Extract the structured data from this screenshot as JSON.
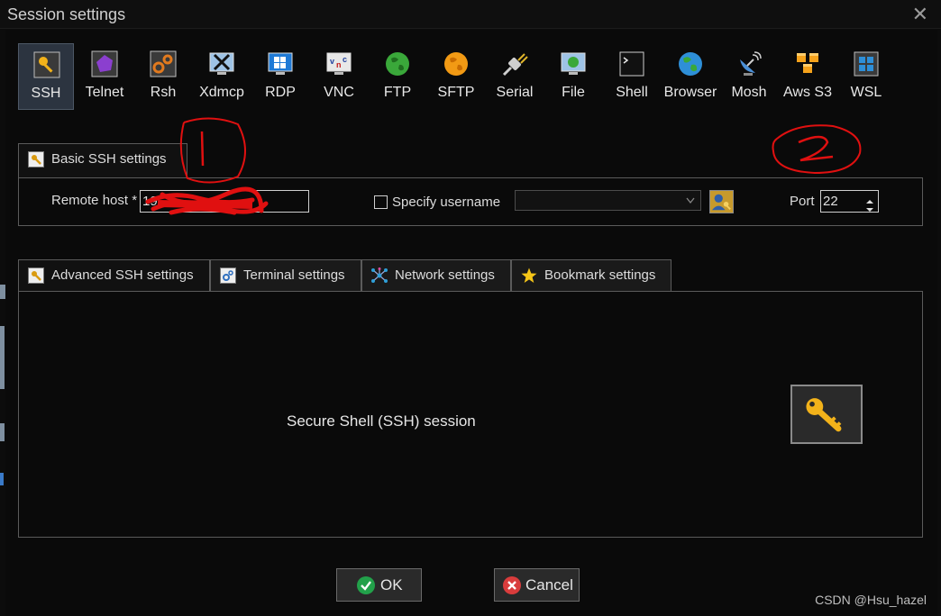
{
  "window": {
    "title": "Session settings",
    "close_glyph": "✕"
  },
  "toolbar": {
    "items": [
      {
        "label": "SSH",
        "icon": "ssh-key-icon",
        "active": true
      },
      {
        "label": "Telnet",
        "icon": "telnet-icon"
      },
      {
        "label": "Rsh",
        "icon": "rsh-icon"
      },
      {
        "label": "Xdmcp",
        "icon": "xdmcp-icon"
      },
      {
        "label": "RDP",
        "icon": "rdp-icon"
      },
      {
        "label": "VNC",
        "icon": "vnc-icon"
      },
      {
        "label": "FTP",
        "icon": "ftp-globe-icon"
      },
      {
        "label": "SFTP",
        "icon": "sftp-globe-icon"
      },
      {
        "label": "Serial",
        "icon": "serial-plug-icon"
      },
      {
        "label": "File",
        "icon": "file-monitor-icon"
      },
      {
        "label": "Shell",
        "icon": "shell-terminal-icon"
      },
      {
        "label": "Browser",
        "icon": "browser-globe-icon"
      },
      {
        "label": "Mosh",
        "icon": "mosh-satellite-icon"
      },
      {
        "label": "Aws S3",
        "icon": "aws-s3-cubes-icon"
      },
      {
        "label": "WSL",
        "icon": "wsl-windows-icon"
      }
    ]
  },
  "basic": {
    "tab_label": "Basic SSH settings",
    "remote_host_label": "Remote host *",
    "remote_host_value": "19",
    "specify_username_label": "Specify username",
    "specify_username_checked": false,
    "username_value": "",
    "port_label": "Port",
    "port_value": "22"
  },
  "tabs": [
    {
      "label": "Advanced SSH settings",
      "icon": "key-icon"
    },
    {
      "label": "Terminal settings",
      "icon": "terminal-gear-icon"
    },
    {
      "label": "Network settings",
      "icon": "network-icon"
    },
    {
      "label": "Bookmark settings",
      "icon": "star-icon"
    }
  ],
  "advanced": {
    "description": "Secure Shell (SSH) session"
  },
  "buttons": {
    "ok_label": "OK",
    "cancel_label": "Cancel"
  },
  "watermark": "CSDN @Hsu_hazel",
  "annotations": {
    "mark1": "1",
    "mark2": "2"
  },
  "colors": {
    "accent": "#2c3440",
    "ok_green": "#22a14a",
    "cancel_red": "#d93c3c",
    "annotation_red": "#e01010"
  }
}
